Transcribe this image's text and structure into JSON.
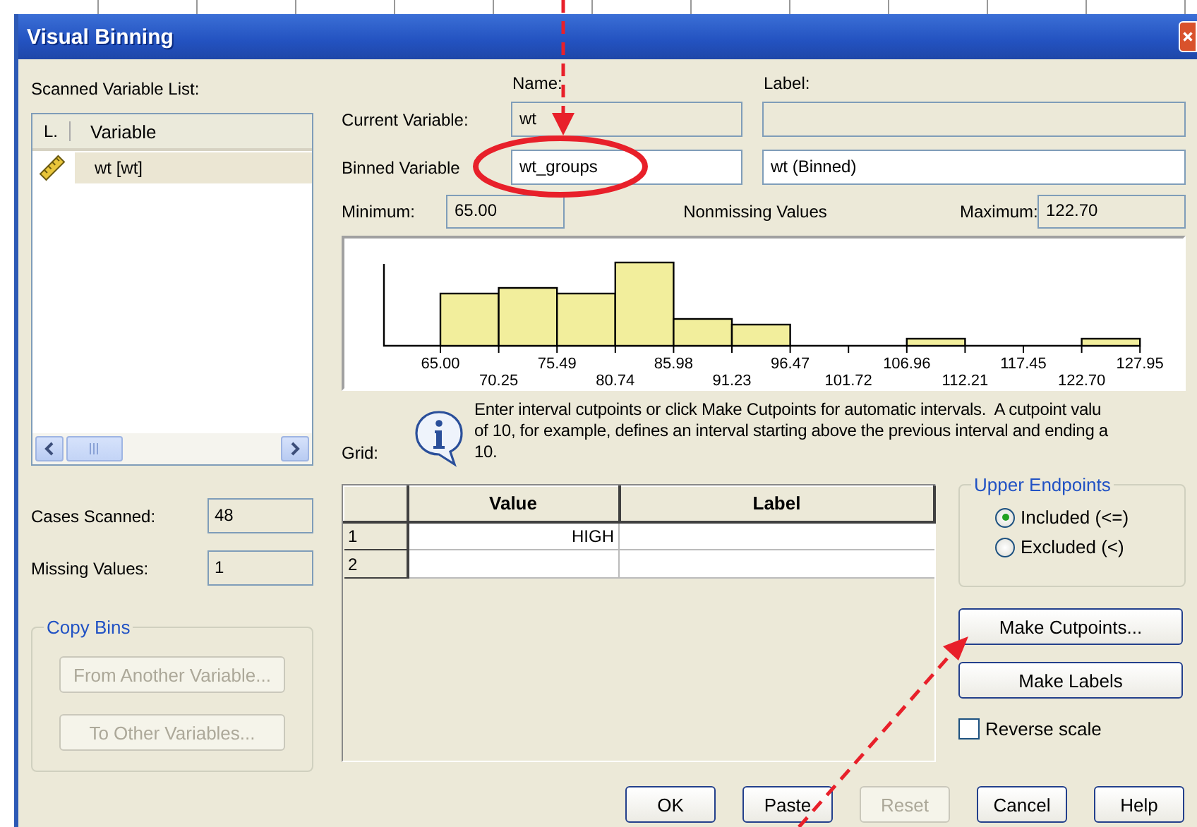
{
  "window": {
    "title": "Visual Binning"
  },
  "scanned_list": {
    "label": "Scanned Variable List:",
    "columns": [
      "L.",
      "Variable"
    ],
    "items": [
      {
        "name": "wt [wt]",
        "selected": true
      }
    ]
  },
  "cases_scanned": {
    "label": "Cases Scanned:",
    "value": "48"
  },
  "missing_values": {
    "label": "Missing Values:",
    "value": "1"
  },
  "copy_bins": {
    "title": "Copy Bins",
    "buttons": [
      {
        "label": "From Another Variable...",
        "disabled": true
      },
      {
        "label": "To Other Variables...",
        "disabled": true
      }
    ]
  },
  "headings": {
    "name": "Name:",
    "label": "Label:"
  },
  "variables": [
    {
      "label": "Current Variable:",
      "name_value": "wt",
      "disabled": true
    },
    {
      "label": "Binned Variable",
      "name_value": "wt_groups",
      "label_value": "wt (Binned)",
      "disabled": false
    }
  ],
  "minimum": {
    "label": "Minimum:",
    "value": "65.00"
  },
  "nonmissing_title": "Nonmissing Values",
  "maximum": {
    "label": "Maximum:",
    "value": "122.70"
  },
  "histogram": {
    "upper_ticks": [
      "65.00",
      "75.49",
      "85.98",
      "96.47",
      "106.96",
      "117.45",
      "127.95"
    ],
    "lower_ticks": [
      "70.25",
      "80.74",
      "91.23",
      "101.72",
      "112.21",
      "122.70"
    ]
  },
  "grid": {
    "label": "Grid:",
    "info_lines": [
      "Enter interval cutpoints or click Make Cutpoints for automatic intervals.  A cutpoint valu",
      "of 10, for example, defines an interval starting above the previous interval and ending a",
      "10."
    ],
    "columns": [
      "Value",
      "Label"
    ],
    "rows": [
      {
        "number": "1",
        "value": "HIGH"
      },
      {
        "number": "2"
      }
    ]
  },
  "upper_endpoints": {
    "title": "Upper Endpoints",
    "options": [
      {
        "label": "Included (<=)",
        "selected": true
      },
      {
        "label": "Excluded (<)",
        "selected": false
      }
    ]
  },
  "actions": [
    {
      "label": "Make Cutpoints..."
    },
    {
      "label": "Make Labels"
    }
  ],
  "reverse_scale": {
    "label": "Reverse scale",
    "checked": false
  },
  "buttons": [
    {
      "label": "OK",
      "disabled": false
    },
    {
      "label": "Paste",
      "disabled": false
    },
    {
      "label": "Reset",
      "disabled": true
    },
    {
      "label": "Cancel",
      "disabled": false
    },
    {
      "label": "Help",
      "disabled": false
    }
  ]
}
